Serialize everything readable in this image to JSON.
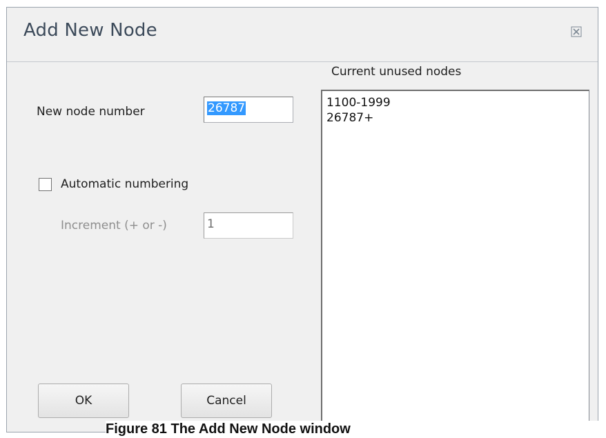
{
  "window": {
    "title": "Add New Node",
    "close_icon": "close-icon"
  },
  "form": {
    "node_number_label": "New node number",
    "node_number_value": "26787",
    "auto_numbering_label": "Automatic numbering",
    "auto_numbering_checked": false,
    "increment_label": "Increment (+ or -)",
    "increment_value": "1"
  },
  "unused": {
    "label": "Current unused nodes",
    "items": [
      "1100-1999",
      "26787+"
    ]
  },
  "buttons": {
    "ok_label": "OK",
    "cancel_label": "Cancel"
  },
  "caption": "Figure 81 The Add New Node window",
  "colors": {
    "selection": "#3399ff",
    "window_bg": "#f0f0f0",
    "title_text": "#3c4a5a"
  }
}
